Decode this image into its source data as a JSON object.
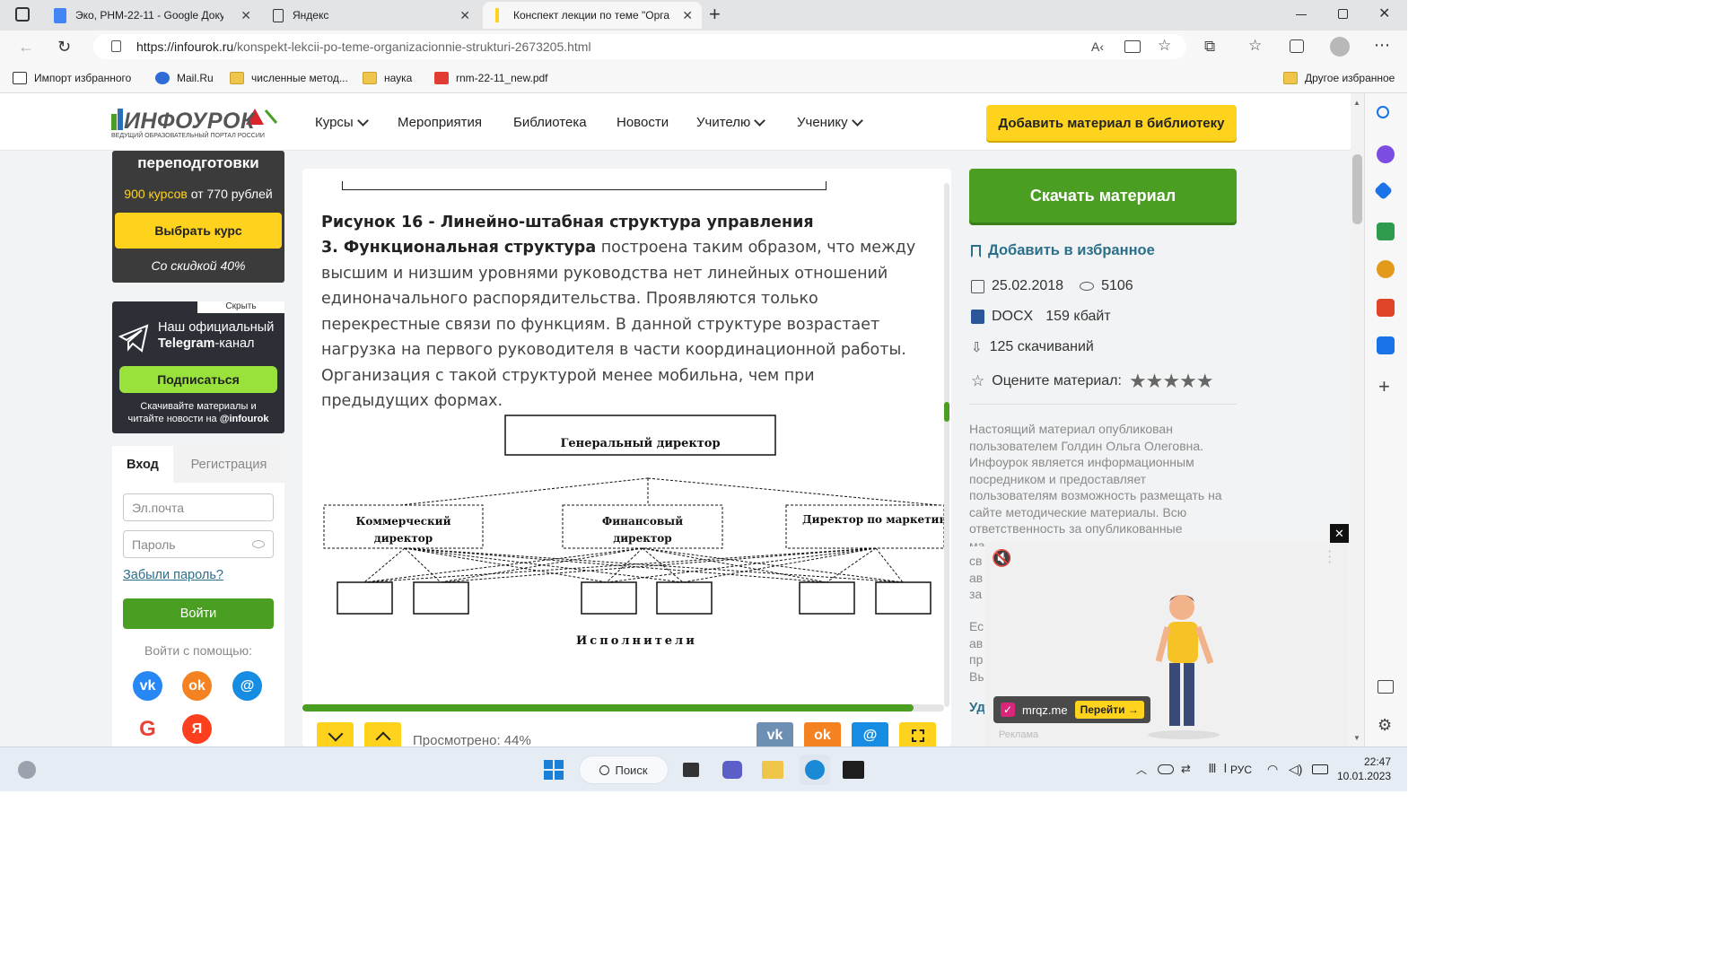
{
  "browser": {
    "tabs": [
      {
        "title": "Эко, РНМ-22-11 - Google Докум",
        "icon": "google-docs-icon"
      },
      {
        "title": "Яндекс",
        "icon": "page-icon"
      },
      {
        "title": "Конспект лекции по теме \"Орга",
        "icon": "infourok-icon",
        "active": true
      }
    ],
    "new_tab": "+",
    "url_host": "https://infourok.ru",
    "url_path": "/konspekt-lekcii-po-teme-organizacionnie-strukturi-2673205.html",
    "favorites": [
      {
        "label": "Импорт избранного",
        "icon": "import-icon"
      },
      {
        "label": "Mail.Ru",
        "icon": "mailru-icon"
      },
      {
        "label": "численные метод...",
        "icon": "folder-icon"
      },
      {
        "label": "наука",
        "icon": "folder-icon"
      },
      {
        "label": "rnm-22-11_new.pdf",
        "icon": "pdf-icon"
      }
    ],
    "other_favorites": "Другое избранное"
  },
  "site": {
    "logo_main": "ИНФОУРОК",
    "logo_sub": "ВЕДУЩИЙ ОБРАЗОВАТЕЛЬНЫЙ ПОРТАЛ РОССИИ",
    "nav": [
      "Курсы",
      "Мероприятия",
      "Библиотека",
      "Новости",
      "Учителю",
      "Ученику"
    ],
    "add_button": "Добавить материал в библиотеку"
  },
  "left": {
    "promo_title": "переподготовки",
    "promo_courses": "900 курсов",
    "promo_price": "от 770 рублей",
    "promo_button": "Выбрать курс",
    "promo_discount": "Со скидкой 40%",
    "tg_hide": "Скрыть",
    "tg_title_1": "Наш официальный",
    "tg_title_2": "Telegram",
    "tg_title_3": "-канал",
    "tg_button": "Подписаться",
    "tg_sub_1": "Скачивайте материалы и",
    "tg_sub_2": "читайте новости на",
    "tg_handle": "@infourok",
    "login_tab": "Вход",
    "register_tab": "Регистрация",
    "email_placeholder": "Эл.почта",
    "password_placeholder": "Пароль",
    "forgot": "Забыли пароль?",
    "login_button": "Войти",
    "login_with": "Войти с помощью:"
  },
  "content": {
    "figure_caption": "Рисунок 16 - Линейно-штабная структура управления",
    "para_bold": "3. Функциональная структура",
    "para_lines": [
      " построена таким образом, что между",
      "высшим и низшим уровнями руководства нет линейных отношений",
      "единоначального распорядительства. Проявляются только",
      "перекрестные связи по функциям. В данной структуре возрастает",
      "нагрузка на первого руководителя в части координационной работы.",
      "Организация с такой структурой менее мобильна, чем при",
      "предыдущих формах."
    ],
    "diagram": {
      "top": "Генеральный директор",
      "mid_1a": "Коммерческий",
      "mid_1b": "директор",
      "mid_2a": "Финансовый",
      "mid_2b": "директор",
      "mid_3": "Директор по маркетин",
      "bottom_label": "Исполнители"
    },
    "viewed": "Просмотрено: 44%",
    "viewed_progress": 0.44
  },
  "right": {
    "download_button": "Скачать материал",
    "favorite": "Добавить в избранное",
    "date": "25.02.2018",
    "views": "5106",
    "format": "DOCX",
    "size": "159 кбайт",
    "downloads": "125 скачиваний",
    "rate_label": "Оцените материал:",
    "stars": "★★★★★",
    "desc": "Настоящий материал опубликован пользователем Голдин Ольга Олеговна. Инфоурок является информационным посредником и предоставляет пользователям возможность размещать на сайте методические материалы. Всю ответственность за опубликованные",
    "desc_tail": "материалы, содержащиеся в них",
    "frag": [
      "св",
      "ав",
      "за"
    ],
    "frag2": [
      "Ес",
      "ав",
      "пр",
      "Вы"
    ],
    "frag3": "Уд"
  },
  "ad": {
    "close": "✕",
    "site": "mrqz.me",
    "go": "Перейти →",
    "label": "Реклама"
  },
  "taskbar": {
    "search": "Поиск",
    "lang": "РУС",
    "time": "22:47",
    "date": "10.01.2023"
  },
  "colors": {
    "green": "#4a9e22",
    "yellow": "#ffd31d",
    "link": "#2b6f8a"
  }
}
